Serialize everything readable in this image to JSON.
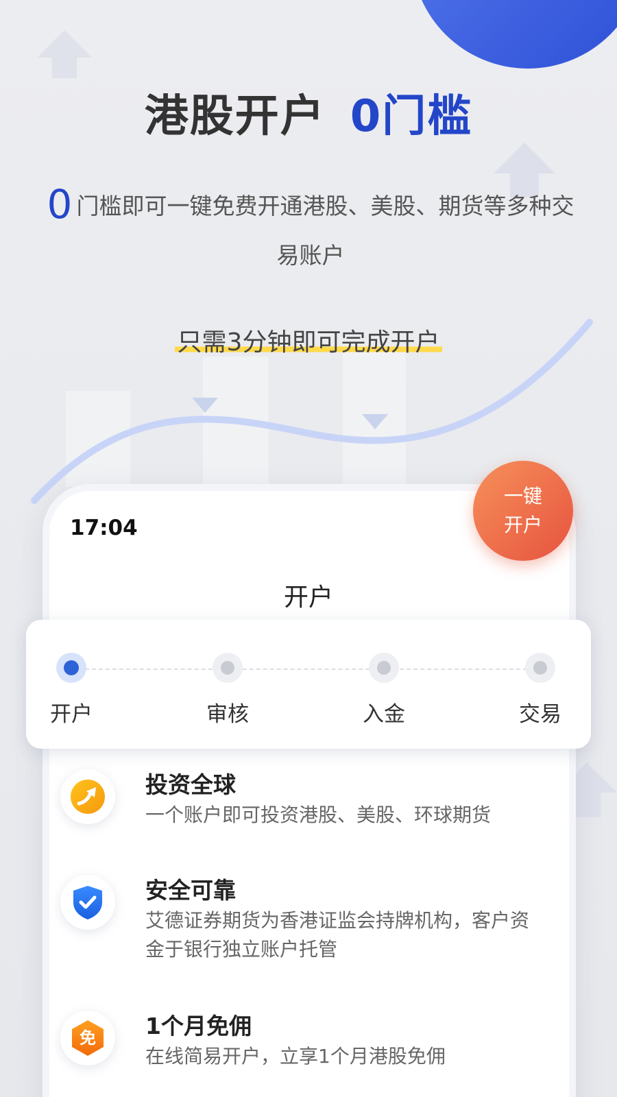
{
  "headline": {
    "part1": "港股开户",
    "part2": "0门槛"
  },
  "subline": {
    "zero": "0",
    "text": "门槛即可一键免费开通港股、美股、期货等多种交易账户"
  },
  "tagline": "只需3分钟即可完成开户",
  "phone": {
    "time": "17:04",
    "title": "开户"
  },
  "cta": {
    "line1": "一键",
    "line2": "开户"
  },
  "steps": [
    {
      "label": "开户",
      "active": true
    },
    {
      "label": "审核",
      "active": false
    },
    {
      "label": "入金",
      "active": false
    },
    {
      "label": "交易",
      "active": false
    }
  ],
  "features": [
    {
      "icon": "trend-arrow-icon",
      "title": "投资全球",
      "desc": "一个账户即可投资港股、美股、环球期货"
    },
    {
      "icon": "shield-check-icon",
      "title": "安全可靠",
      "desc": "艾德证券期货为香港证监会持牌机构，客户资金于银行独立账户托管"
    },
    {
      "icon": "free-badge-icon",
      "badge": "免",
      "title": "1个月免佣",
      "desc": "在线简易开户，立享1个月港股免佣"
    }
  ],
  "colors": {
    "brand_blue": "#2346c9",
    "cta_orange": "#ec6a48",
    "highlight_yellow": "#ffd94a"
  }
}
